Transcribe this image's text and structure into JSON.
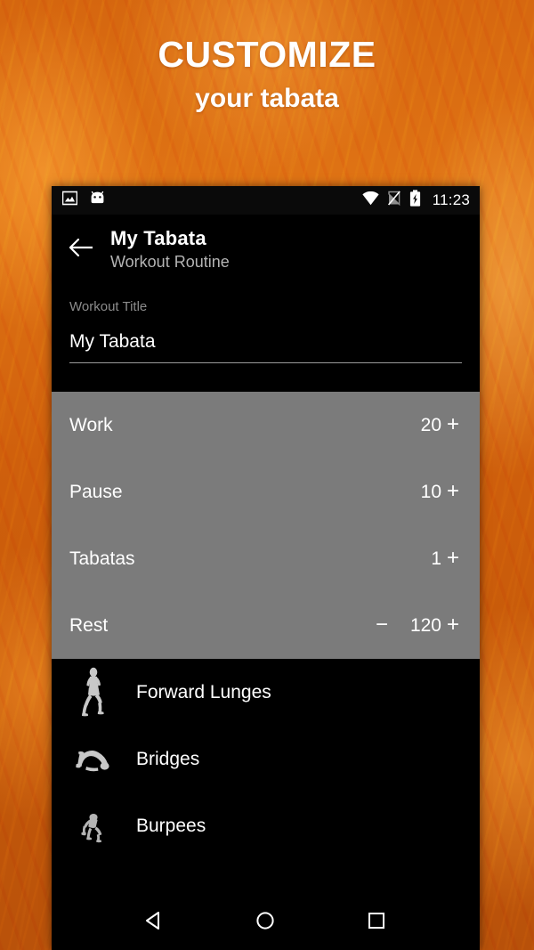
{
  "promo": {
    "headline_line1": "CUSTOMIZE",
    "headline_line2": "your tabata"
  },
  "colors": {
    "background_orange": "#d5660f",
    "panel_gray": "#7b7b7b",
    "screen_black": "#000000",
    "text_white": "#ffffff",
    "text_muted": "#8c8c8c"
  },
  "statusbar": {
    "left_icons": [
      "screenshot-icon",
      "android-head-icon"
    ],
    "right_icons": [
      "wifi-icon",
      "no-sim-icon",
      "battery-charging-icon"
    ],
    "time": "11:23"
  },
  "appbar": {
    "back_icon": "arrow-left-icon",
    "title": "My Tabata",
    "subtitle": "Workout Routine"
  },
  "workout_title_field": {
    "label": "Workout Title",
    "value": "My Tabata",
    "placeholder": "Workout Title"
  },
  "settings": {
    "rows": [
      {
        "label": "Work",
        "value": "20",
        "minus": "−",
        "plus": "+",
        "has_minus": false
      },
      {
        "label": "Pause",
        "value": "10",
        "minus": "−",
        "plus": "+",
        "has_minus": false
      },
      {
        "label": "Tabatas",
        "value": "1",
        "minus": "−",
        "plus": "+",
        "has_minus": false
      },
      {
        "label": "Rest",
        "value": "120",
        "minus": "−",
        "plus": "+",
        "has_minus": true
      }
    ]
  },
  "exercises": {
    "items": [
      {
        "name": "Forward Lunges",
        "thumb": "lunge-figure-thumbnail"
      },
      {
        "name": "Bridges",
        "thumb": "bridge-figure-thumbnail"
      },
      {
        "name": "Burpees",
        "thumb": "burpee-figure-thumbnail"
      }
    ]
  },
  "navbar": {
    "back": "nav-back-icon",
    "home": "nav-home-icon",
    "recents": "nav-recents-icon"
  }
}
